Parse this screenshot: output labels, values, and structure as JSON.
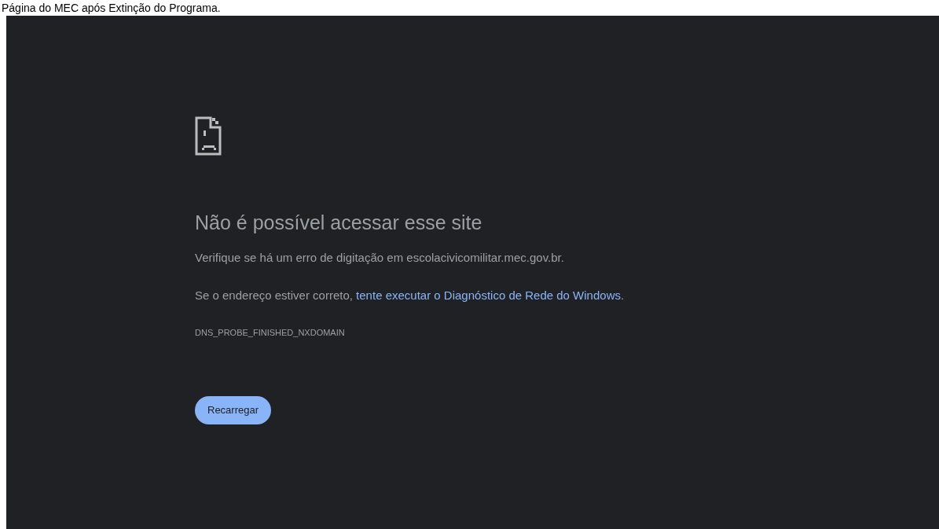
{
  "caption": "Página do MEC após Extinção do Programa.",
  "error_page": {
    "title": "Não é possível acessar esse site",
    "line_1": "Verifique se há um erro de digitação em escolacivicomilitar.mec.gov.br.",
    "line_2_text": "Se o endereço estiver correto, ",
    "line_2_link": "tente executar o Diagnóstico de Rede do Windows",
    "line_2_end": ".",
    "error_code": "DNS_PROBE_FINISHED_NXDOMAIN",
    "button": "Recarregar"
  }
}
